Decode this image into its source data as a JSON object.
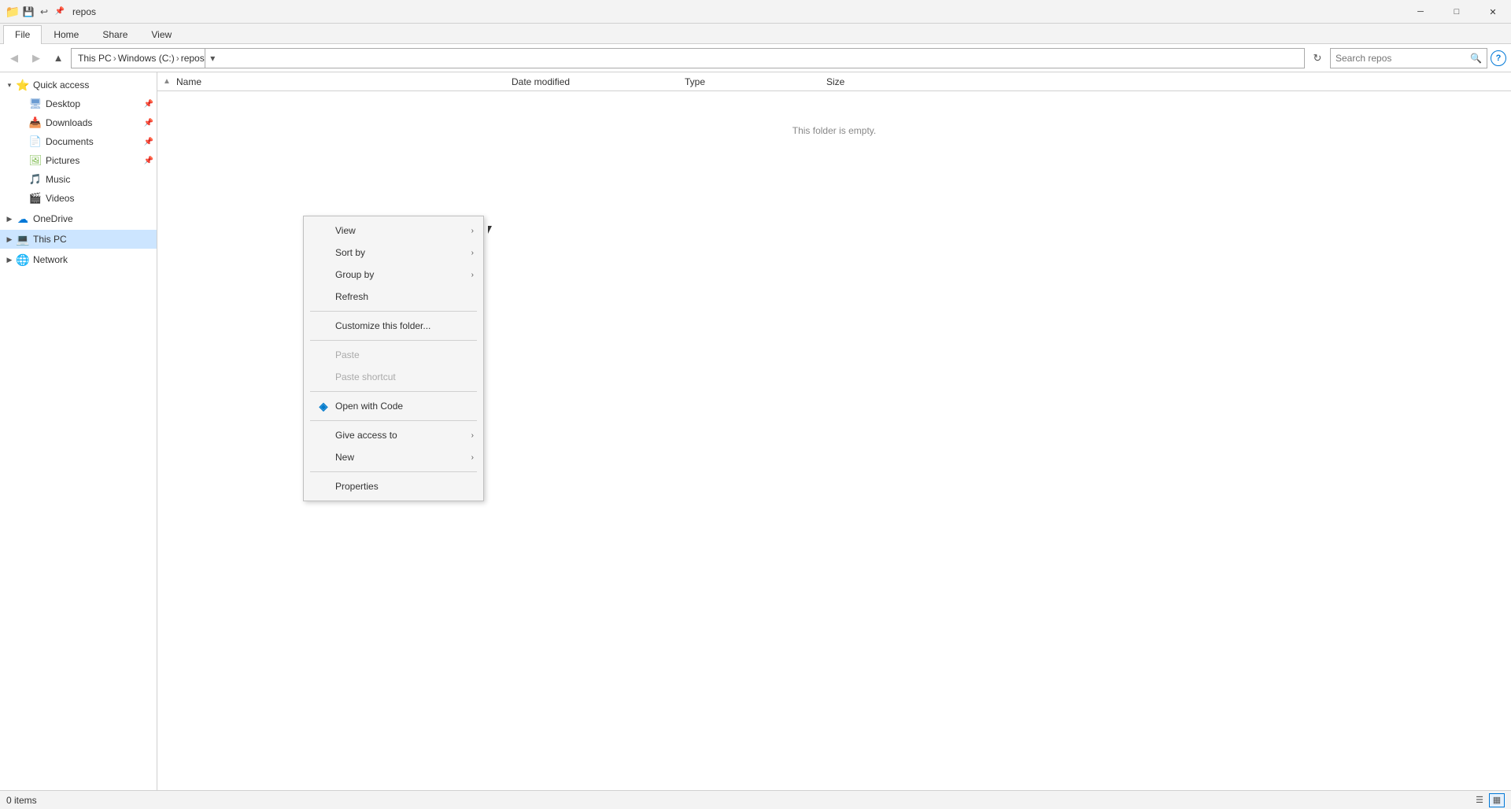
{
  "titleBar": {
    "title": "repos",
    "icons": {
      "folder": "📁",
      "save": "💾",
      "quick": "⬇",
      "pin": "📌"
    },
    "controls": {
      "minimize": "─",
      "restore": "□",
      "close": "✕"
    }
  },
  "ribbonTabs": [
    {
      "label": "File",
      "active": true
    },
    {
      "label": "Home",
      "active": false
    },
    {
      "label": "Share",
      "active": false
    },
    {
      "label": "View",
      "active": false
    }
  ],
  "addressBar": {
    "path": [
      "This PC",
      "Windows (C:)",
      "repos"
    ],
    "searchPlaceholder": "Search repos",
    "refreshIcon": "↻"
  },
  "sidebar": {
    "quickAccess": {
      "label": "Quick access",
      "expanded": true,
      "icon": "⭐"
    },
    "items": [
      {
        "label": "Desktop",
        "icon": "🖥",
        "pinned": true
      },
      {
        "label": "Downloads",
        "icon": "📥",
        "pinned": true
      },
      {
        "label": "Documents",
        "icon": "📄",
        "pinned": true
      },
      {
        "label": "Pictures",
        "icon": "🖼",
        "pinned": true
      },
      {
        "label": "Music",
        "icon": "🎵",
        "pinned": false
      },
      {
        "label": "Videos",
        "icon": "🎬",
        "pinned": false
      }
    ],
    "onedrive": {
      "label": "OneDrive",
      "icon": "☁",
      "expanded": false
    },
    "thispc": {
      "label": "This PC",
      "icon": "💻",
      "expanded": false,
      "selected": true
    },
    "network": {
      "label": "Network",
      "icon": "🌐",
      "expanded": false
    }
  },
  "columns": {
    "name": "Name",
    "dateModified": "Date modified",
    "type": "Type",
    "size": "Size"
  },
  "content": {
    "emptyMessage": "This folder is empty."
  },
  "contextMenu": {
    "items": [
      {
        "label": "View",
        "hasArrow": true,
        "icon": "",
        "type": "item"
      },
      {
        "label": "Sort by",
        "hasArrow": true,
        "icon": "",
        "type": "item"
      },
      {
        "label": "Group by",
        "hasArrow": true,
        "icon": "",
        "type": "item"
      },
      {
        "label": "Refresh",
        "hasArrow": false,
        "icon": "",
        "type": "item"
      },
      {
        "type": "separator"
      },
      {
        "label": "Customize this folder...",
        "hasArrow": false,
        "icon": "",
        "type": "item"
      },
      {
        "type": "separator"
      },
      {
        "label": "Paste",
        "hasArrow": false,
        "icon": "",
        "type": "item",
        "disabled": true
      },
      {
        "label": "Paste shortcut",
        "hasArrow": false,
        "icon": "",
        "type": "item",
        "disabled": true
      },
      {
        "type": "separator"
      },
      {
        "label": "Open with Code",
        "hasArrow": false,
        "icon": "vscode",
        "type": "item"
      },
      {
        "type": "separator"
      },
      {
        "label": "Give access to",
        "hasArrow": true,
        "icon": "",
        "type": "item"
      },
      {
        "label": "New",
        "hasArrow": true,
        "icon": "",
        "type": "item"
      },
      {
        "type": "separator"
      },
      {
        "label": "Properties",
        "hasArrow": false,
        "icon": "",
        "type": "item"
      }
    ]
  },
  "statusBar": {
    "itemCount": "0 items",
    "viewIcons": [
      "☰",
      "▦"
    ]
  }
}
